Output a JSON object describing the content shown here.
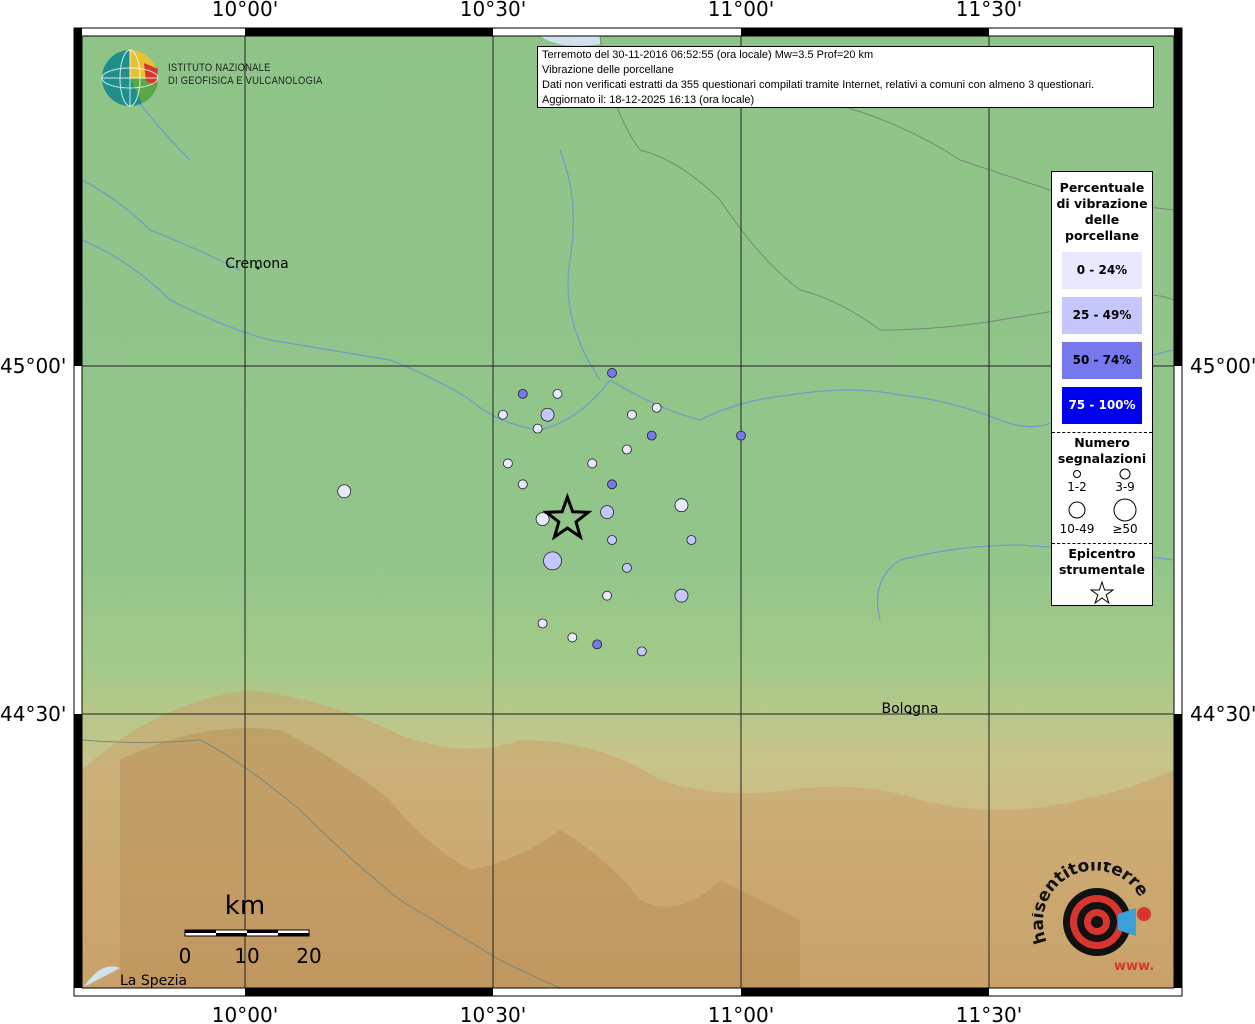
{
  "map": {
    "info_lines": [
      "Terremoto del 30-11-2016 06:52:55 (ora locale) Mw=3.5 Prof=20 km",
      "Vibrazione delle porcellane",
      "Dati non verificati estratti da 355 questionari compilati tramite Internet, relativi a comuni con almeno 3 questionari.",
      "Aggiornato il: 18-12-2025 16:13 (ora locale)"
    ],
    "lon_labels": [
      "10°00'",
      "10°30'",
      "11°00'",
      "11°30'"
    ],
    "lat_labels": [
      "45°00'",
      "44°30'"
    ],
    "cities": [
      "Cremona",
      "Bologna",
      "La Spezia"
    ],
    "institute_line1": "ISTITUTO NAZIONALE",
    "institute_line2": "DI GEOFISICA E VULCANOLOGIA",
    "scale": {
      "unit": "km",
      "ticks": [
        "0",
        "10",
        "20"
      ]
    },
    "brand_text": "haisentitoilterremoto.it",
    "brand_sub": "www."
  },
  "legend": {
    "title": "Percentuale di vibrazione delle porcellane",
    "classes": [
      {
        "label": "0 - 24%",
        "color": "#e8e8ff"
      },
      {
        "label": "25 - 49%",
        "color": "#c6c6ff"
      },
      {
        "label": "50 - 74%",
        "color": "#7777ee"
      },
      {
        "label": "75 - 100%",
        "color": "#0000ee"
      }
    ],
    "count_title": "Numero segnalazioni",
    "count_classes": [
      "1-2",
      "3-9",
      "10-49",
      "≥50"
    ],
    "epicenter_title": "Epicentro strumentale"
  },
  "chart_data": {
    "type": "scatter",
    "epicenter": {
      "lon": 10.65,
      "lat": 44.78
    },
    "points": [
      {
        "lon": 10.74,
        "lat": 44.99,
        "cls": 2,
        "size": 1
      },
      {
        "lon": 10.56,
        "lat": 44.96,
        "cls": 2,
        "size": 1
      },
      {
        "lon": 10.63,
        "lat": 44.96,
        "cls": 0,
        "size": 1
      },
      {
        "lon": 10.52,
        "lat": 44.93,
        "cls": 0,
        "size": 1
      },
      {
        "lon": 10.61,
        "lat": 44.93,
        "cls": 1,
        "size": 2
      },
      {
        "lon": 10.83,
        "lat": 44.94,
        "cls": 0,
        "size": 1
      },
      {
        "lon": 10.78,
        "lat": 44.93,
        "cls": 0,
        "size": 1
      },
      {
        "lon": 10.59,
        "lat": 44.91,
        "cls": 0,
        "size": 1
      },
      {
        "lon": 10.82,
        "lat": 44.9,
        "cls": 2,
        "size": 1
      },
      {
        "lon": 11.0,
        "lat": 44.9,
        "cls": 2,
        "size": 1
      },
      {
        "lon": 10.77,
        "lat": 44.88,
        "cls": 0,
        "size": 1
      },
      {
        "lon": 10.7,
        "lat": 44.86,
        "cls": 0,
        "size": 1
      },
      {
        "lon": 10.53,
        "lat": 44.86,
        "cls": 0,
        "size": 1
      },
      {
        "lon": 10.56,
        "lat": 44.83,
        "cls": 0,
        "size": 1
      },
      {
        "lon": 10.74,
        "lat": 44.83,
        "cls": 2,
        "size": 1
      },
      {
        "lon": 10.2,
        "lat": 44.82,
        "cls": 0,
        "size": 2
      },
      {
        "lon": 10.88,
        "lat": 44.8,
        "cls": 0,
        "size": 2
      },
      {
        "lon": 10.73,
        "lat": 44.79,
        "cls": 1,
        "size": 2
      },
      {
        "lon": 10.6,
        "lat": 44.78,
        "cls": 0,
        "size": 2
      },
      {
        "lon": 10.9,
        "lat": 44.75,
        "cls": 1,
        "size": 1
      },
      {
        "lon": 10.74,
        "lat": 44.75,
        "cls": 1,
        "size": 1
      },
      {
        "lon": 10.62,
        "lat": 44.72,
        "cls": 1,
        "size": 3
      },
      {
        "lon": 10.77,
        "lat": 44.71,
        "cls": 1,
        "size": 1
      },
      {
        "lon": 10.73,
        "lat": 44.67,
        "cls": 0,
        "size": 1
      },
      {
        "lon": 10.88,
        "lat": 44.67,
        "cls": 1,
        "size": 2
      },
      {
        "lon": 10.6,
        "lat": 44.63,
        "cls": 0,
        "size": 1
      },
      {
        "lon": 10.66,
        "lat": 44.61,
        "cls": 0,
        "size": 1
      },
      {
        "lon": 10.71,
        "lat": 44.6,
        "cls": 2,
        "size": 1
      },
      {
        "lon": 10.8,
        "lat": 44.59,
        "cls": 1,
        "size": 1
      }
    ]
  }
}
